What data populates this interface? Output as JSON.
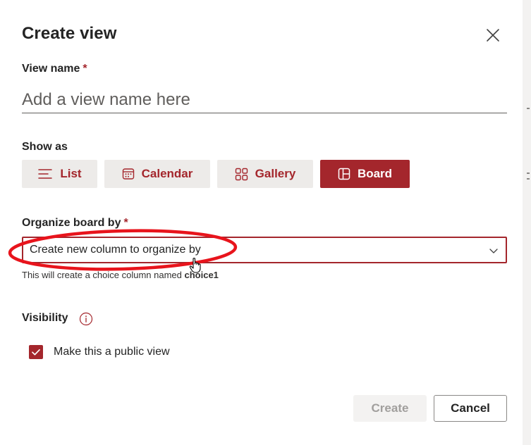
{
  "dialog": {
    "title": "Create view",
    "close_icon": "close-icon"
  },
  "view_name": {
    "label": "View name",
    "required_mark": "*",
    "placeholder": "Add a view name here",
    "value": ""
  },
  "show_as": {
    "label": "Show as",
    "options": [
      {
        "label": "List",
        "icon": "list-icon",
        "selected": false
      },
      {
        "label": "Calendar",
        "icon": "calendar-icon",
        "selected": false
      },
      {
        "label": "Gallery",
        "icon": "gallery-icon",
        "selected": false
      },
      {
        "label": "Board",
        "icon": "board-icon",
        "selected": true
      }
    ]
  },
  "organize": {
    "label": "Organize board by",
    "required_mark": "*",
    "selected_value": "Create new column to organize by",
    "helper_prefix": "This will create a choice column named ",
    "helper_column_name": "choice1"
  },
  "visibility": {
    "label": "Visibility",
    "info_icon": "info-icon",
    "public_checkbox_label": "Make this a public view",
    "public_checked": true
  },
  "footer": {
    "create_label": "Create",
    "cancel_label": "Cancel"
  },
  "colors": {
    "accent": "#a4262c",
    "annotation": "#e8141c"
  }
}
